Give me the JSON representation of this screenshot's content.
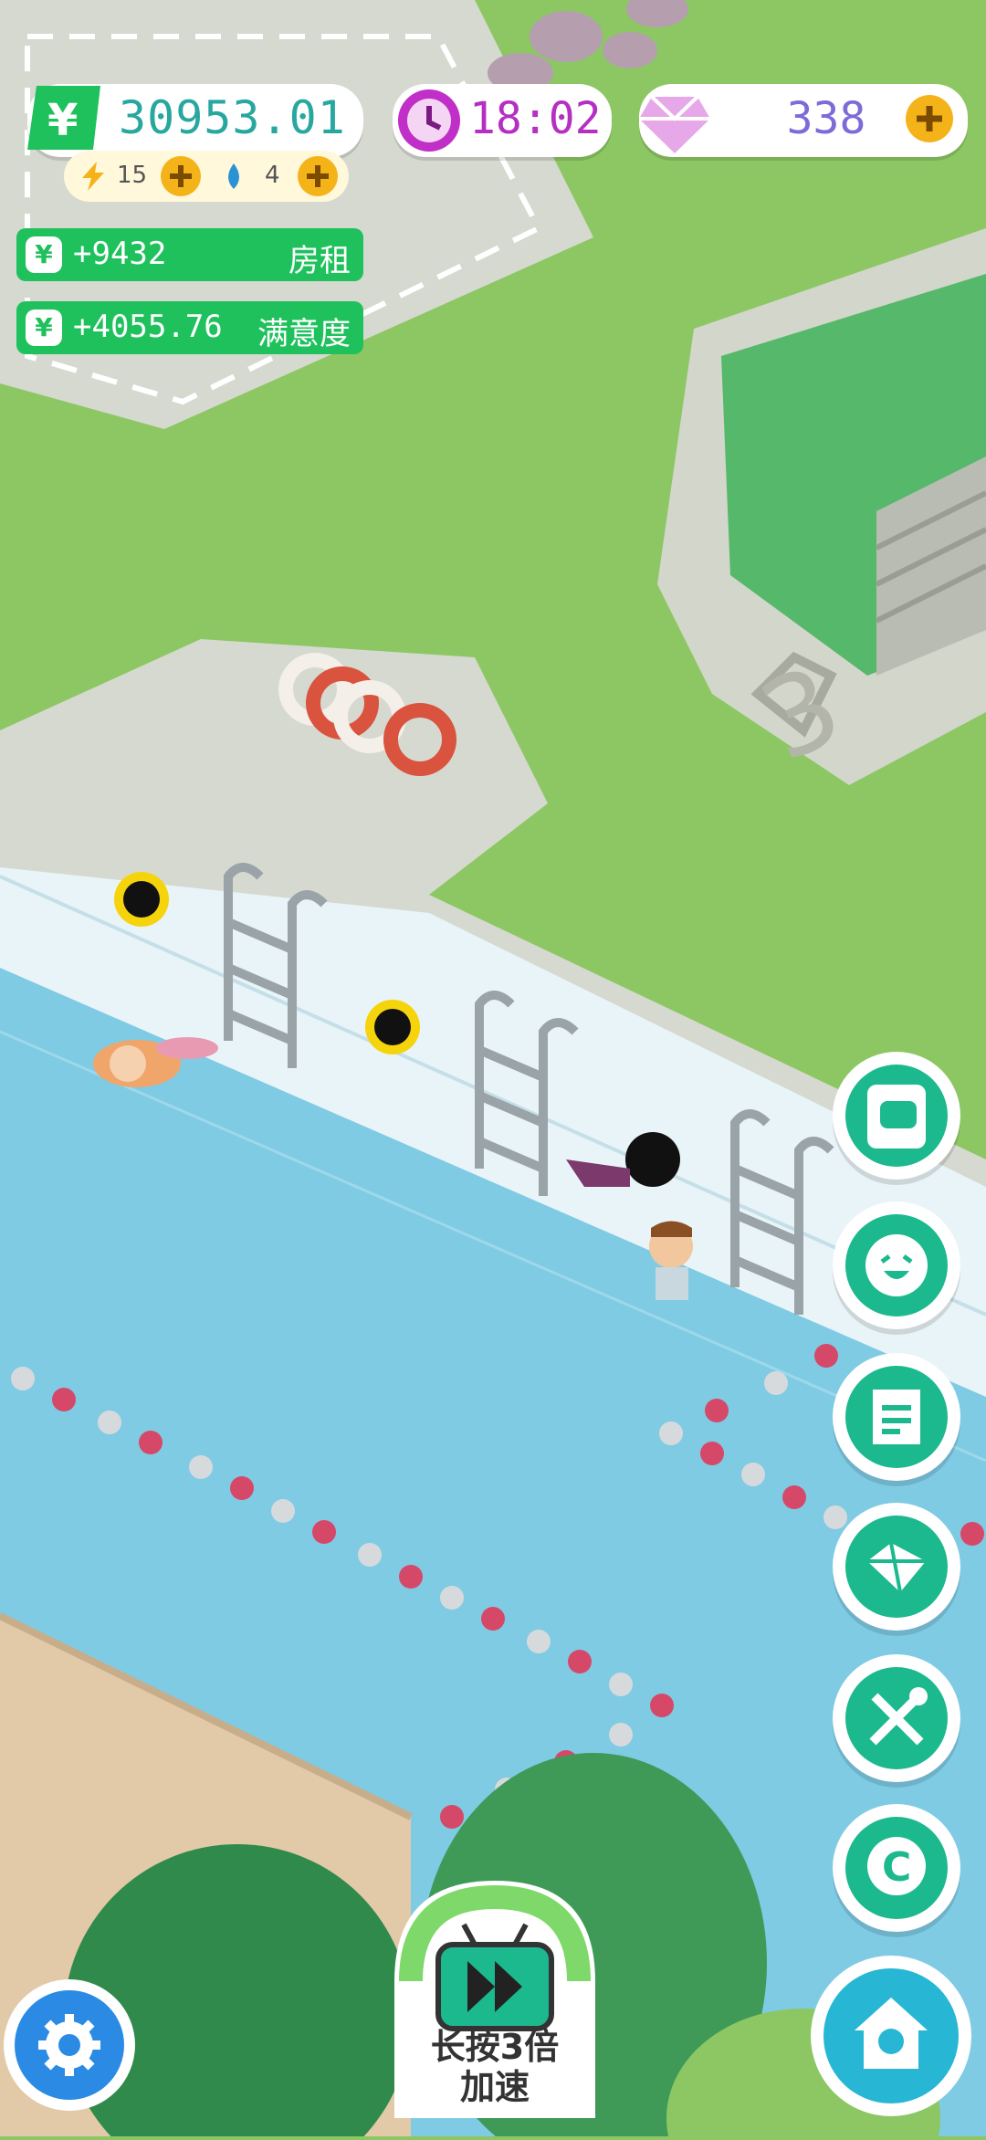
{
  "hud": {
    "money": "30953.01",
    "money_icon": "yen-icon",
    "energy": "15",
    "water": "4",
    "time": "18:02",
    "gems": "338"
  },
  "income": [
    {
      "amount": "+9432",
      "label": "房租"
    },
    {
      "amount": "+4055.76",
      "label": "满意度"
    }
  ],
  "scene": {
    "area_number": "3"
  },
  "side_buttons": [
    {
      "name": "chat-button",
      "icon": "speech-card-icon"
    },
    {
      "name": "emoji-button",
      "icon": "smiley-icon"
    },
    {
      "name": "tasks-button",
      "icon": "notes-icon"
    },
    {
      "name": "gem-shop-button",
      "icon": "gem-icon"
    },
    {
      "name": "build-button",
      "icon": "tools-icon"
    },
    {
      "name": "coin-button",
      "icon": "coin-c-icon"
    }
  ],
  "speed": {
    "label_line1": "长按3倍",
    "label_line2": "加速"
  },
  "colors": {
    "grass": "#8cc764",
    "pool_water": "#7fcbe4",
    "hud_green": "#1fc15d",
    "button_teal": "#1db98e"
  }
}
